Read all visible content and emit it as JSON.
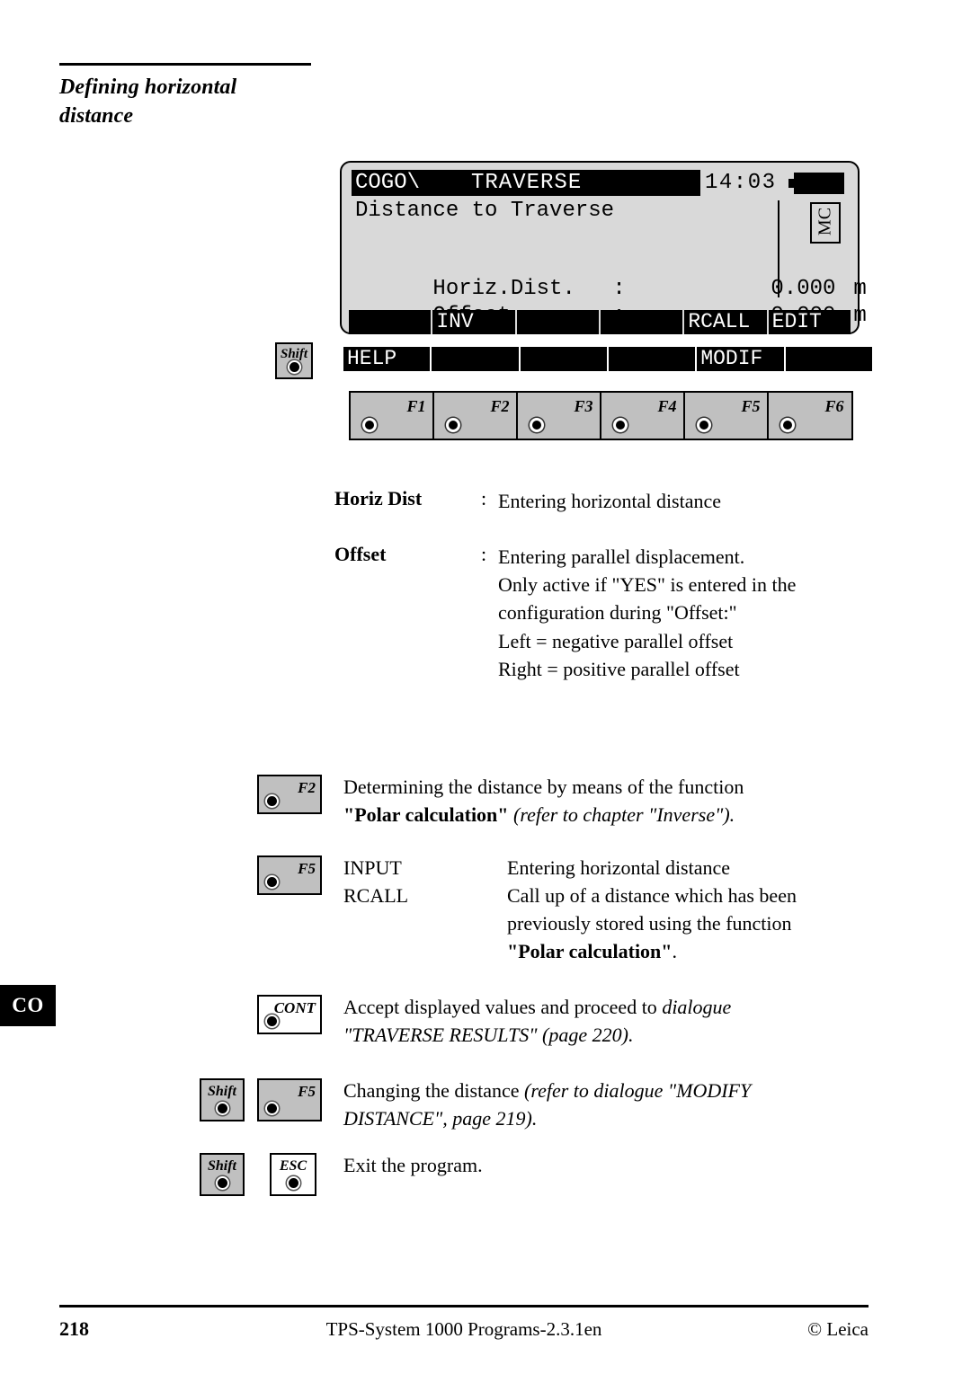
{
  "page": {
    "title": "Defining horizontal\ndistance",
    "title_line1": "Defining horizontal",
    "title_line2": "distance",
    "margin_tab": "CO"
  },
  "lcd": {
    "app": "COGO\\",
    "screen_name": "TRAVERSE",
    "time": "14:03",
    "battery_icon": "battery-icon",
    "subtitle": "Distance to Traverse",
    "mode_badge": "MC",
    "fields": [
      {
        "label": "Horiz.Dist.",
        "colon": ":",
        "value": "0.000",
        "unit": "m"
      },
      {
        "label": "Offset",
        "colon": ":",
        "value": "0.000",
        "unit": "m"
      }
    ],
    "softkeys_primary": [
      "",
      "INV",
      "",
      "",
      "RCALL",
      "EDIT"
    ],
    "softkeys_shift": [
      "HELP",
      "",
      "",
      "",
      "MODIF",
      ""
    ],
    "shift_key_label": "Shift",
    "function_keys": [
      "F1",
      "F2",
      "F3",
      "F4",
      "F5",
      "F6"
    ]
  },
  "definitions": [
    {
      "term": "Horiz Dist",
      "colon": ":",
      "lines": [
        "Entering horizontal distance"
      ]
    },
    {
      "term": "Offset",
      "colon": ":",
      "lines": [
        "Entering parallel displacement.",
        "Only active if \"YES\" is entered in the",
        "configuration during \"Offset:\"",
        "Left = negative parallel offset",
        "Right = positive parallel offset"
      ]
    }
  ],
  "actions": {
    "f2": {
      "key": "F2",
      "line1": "Determining the distance by means of the function",
      "line2_quote_bold": "\"Polar calculation\"",
      "line2_italic": " (refer to chapter \"Inverse\")."
    },
    "f5": {
      "key": "F5",
      "rows": [
        {
          "key": "INPUT",
          "desc_lines": [
            "Entering horizontal distance"
          ]
        },
        {
          "key": "RCALL",
          "desc_lines": [
            "Call up of a distance which has been",
            "previously stored using the function"
          ]
        }
      ],
      "closing_bold": "\"Polar calculation\"",
      "closing_tail": "."
    },
    "cont": {
      "key": "CONT",
      "line1_plain": "Accept displayed values and proceed to ",
      "line1_italic": "dialogue",
      "line2_italic": "\"TRAVERSE RESULTS\" (page 220)."
    },
    "shift_f5": {
      "key1": "Shift",
      "key2": "F5",
      "line1_plain": "Changing the distance ",
      "line1_italic": "(refer to dialogue  \"MODIFY",
      "line2_italic": "DISTANCE\", page 219)."
    },
    "shift_esc": {
      "key1": "Shift",
      "key2": "ESC",
      "text": "Exit the program."
    }
  },
  "footer": {
    "page_number": "218",
    "center": "TPS-System 1000 Programs-2.3.1en",
    "copyright": "© Leica"
  }
}
